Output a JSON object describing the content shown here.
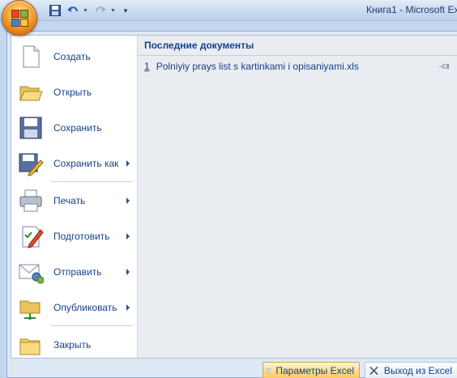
{
  "window": {
    "title": "Книга1 - Microsoft Ex"
  },
  "quick_access": {
    "items": [
      {
        "icon": "save-icon"
      },
      {
        "icon": "undo-icon"
      },
      {
        "icon": "redo-icon"
      },
      {
        "icon": "customize-icon"
      }
    ]
  },
  "menu": {
    "items": [
      {
        "label": "Создать",
        "icon": "new-document-icon",
        "submenu": false
      },
      {
        "label": "Открыть",
        "icon": "open-folder-icon",
        "submenu": false
      },
      {
        "label": "Сохранить",
        "icon": "save-disk-icon",
        "submenu": false
      },
      {
        "label": "Сохранить как",
        "icon": "save-as-icon",
        "submenu": true
      },
      {
        "label": "Печать",
        "icon": "printer-icon",
        "submenu": true
      },
      {
        "label": "Подготовить",
        "icon": "prepare-icon",
        "submenu": true
      },
      {
        "label": "Отправить",
        "icon": "send-mail-icon",
        "submenu": true
      },
      {
        "label": "Опубликовать",
        "icon": "publish-icon",
        "submenu": true
      },
      {
        "label": "Закрыть",
        "icon": "close-folder-icon",
        "submenu": false
      }
    ]
  },
  "recent": {
    "header": "Последние документы",
    "documents": [
      {
        "number": "1",
        "name": "Polniyiy prays list s kartinkami i opisaniyami.xls"
      }
    ]
  },
  "buttons": {
    "options": "Параметры Excel",
    "exit": "Выход из Excel"
  },
  "colors": {
    "accent": "#15428b",
    "options_highlight": "#ffd88a"
  }
}
